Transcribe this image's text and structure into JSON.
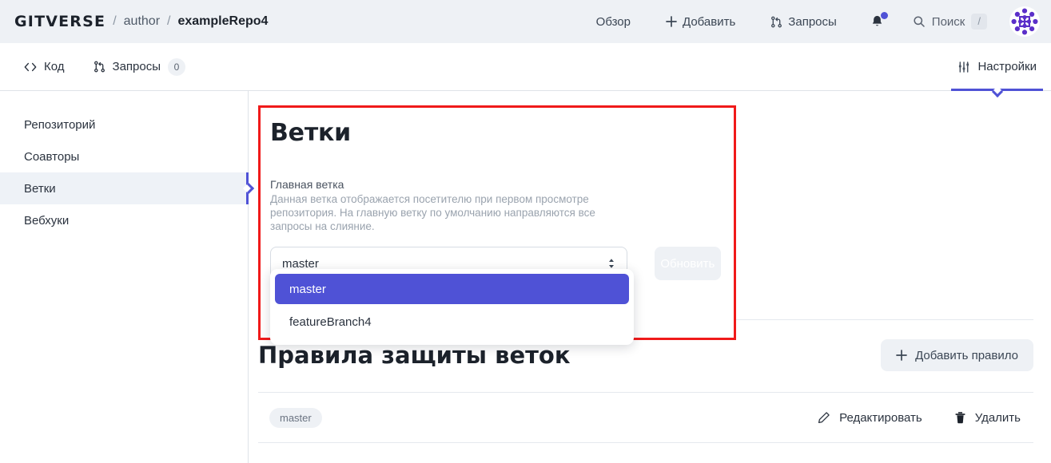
{
  "header": {
    "logo_text": "GITVERSE",
    "separator": "/",
    "owner": "author",
    "repo": "exampleRepo4",
    "nav": [
      {
        "label": "Обзор",
        "icon": ""
      },
      {
        "label": "Добавить",
        "icon": "plus-icon"
      },
      {
        "label": "Запросы",
        "icon": "pull-request-icon"
      }
    ],
    "bell_icon": "bell-icon",
    "search": {
      "label": "Поиск",
      "shortcut": "/",
      "icon": "search-icon"
    },
    "avatar_icon": "user-avatar"
  },
  "tabs": [
    {
      "label": "Код",
      "icon": "code-icon",
      "count": null,
      "active": false
    },
    {
      "label": "Запросы",
      "icon": "pull-request-icon",
      "count": "0",
      "active": false
    },
    {
      "label": "Настройки",
      "icon": "sliders-icon",
      "count": null,
      "active": true
    }
  ],
  "sidebar": {
    "items": [
      {
        "label": "Репозиторий",
        "active": false
      },
      {
        "label": "Соавторы",
        "active": false
      },
      {
        "label": "Ветки",
        "active": true
      },
      {
        "label": "Вебхуки",
        "active": false
      }
    ]
  },
  "branches_panel": {
    "title": "Ветки",
    "field_label": "Главная ветка",
    "field_help": "Данная ветка отображается посетителю при первом просмотре репозитория. На главную ветку по умолчанию направляются все запросы на слияние.",
    "select_value": "master",
    "select_caret_icon": "chevron-up-down-icon",
    "update_button": "Обновить",
    "dropdown_options": [
      {
        "label": "master",
        "selected": true
      },
      {
        "label": "featureBranch4",
        "selected": false
      }
    ]
  },
  "rules": {
    "title": "Правила защиты веток",
    "add_button": {
      "label": "Добавить правило",
      "icon": "plus-icon"
    },
    "rows": [
      {
        "branch": "master",
        "edit_label": "Редактировать",
        "edit_icon": "pencil-icon",
        "delete_label": "Удалить",
        "delete_icon": "trash-icon"
      }
    ]
  },
  "colors": {
    "accent": "#4f52d6",
    "highlight_box": "#f01a1a",
    "header_bg": "#eef1f5",
    "muted_text": "#9aa3ae"
  }
}
